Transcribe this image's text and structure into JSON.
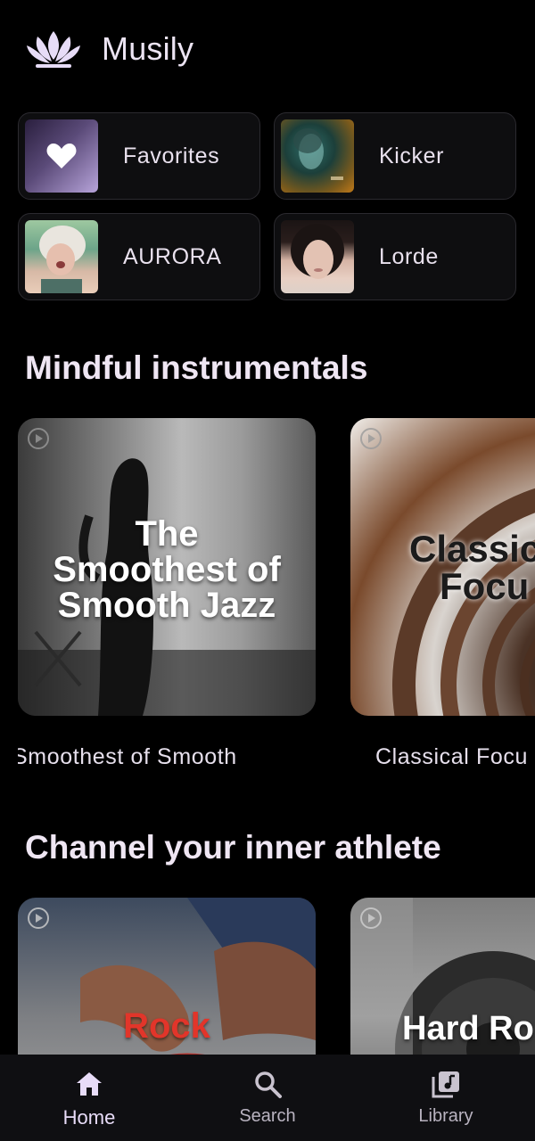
{
  "app": {
    "title": "Musily"
  },
  "quick_access": [
    {
      "label": "Favorites",
      "icon": "heart-icon"
    },
    {
      "label": "Kicker"
    },
    {
      "label": "AURORA"
    },
    {
      "label": "Lorde"
    }
  ],
  "sections": [
    {
      "title": "Mindful instrumentals",
      "cards": [
        {
          "art_text": [
            "The",
            "Smoothest of",
            "Smooth Jazz"
          ],
          "label": "Smoothest of Smooth"
        },
        {
          "art_text": [
            "Classic",
            "Focu"
          ],
          "label": "Classical Focu"
        }
      ]
    },
    {
      "title": "Channel your inner athlete",
      "cards": [
        {
          "art_text": [
            "Rock"
          ],
          "label": ""
        },
        {
          "art_text": [
            "Hard Ro"
          ],
          "label": ""
        }
      ]
    }
  ],
  "nav": [
    {
      "label": "Home",
      "icon": "home-icon",
      "active": true
    },
    {
      "label": "Search",
      "icon": "search-icon",
      "active": false
    },
    {
      "label": "Library",
      "icon": "library-icon",
      "active": false
    }
  ],
  "colors": {
    "accent": "#e8dcf8",
    "background": "#000000",
    "nav_background": "#0f0f12"
  }
}
